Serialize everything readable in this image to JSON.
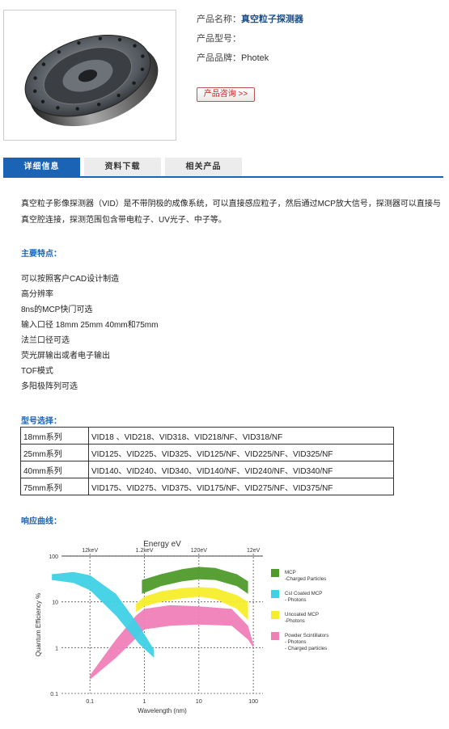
{
  "product": {
    "name_label": "产品名称：",
    "name_value": "真空粒子探测器",
    "model_label": "产品型号：",
    "model_value": "",
    "brand_label": "产品品牌：",
    "brand_value": "Photek",
    "inquiry_button": "产品咨询 >>"
  },
  "tabs": [
    {
      "label": "详细信息",
      "active": true
    },
    {
      "label": "资料下载",
      "active": false
    },
    {
      "label": "相关产品",
      "active": false
    }
  ],
  "intro": "真空粒子影像探测器（VID）是不带阴极的成像系统，可以直接感应粒子，然后通过MCP放大信号，探测器可以直接与真空腔连接，探测范围包含带电粒子、UV光子、中子等。",
  "features_title": "主要特点：",
  "features": [
    "可以按照客户CAD设计制造",
    "高分辨率",
    "8ns的MCP快门可选",
    "输入口径 18mm 25mm 40mm和75mm",
    "法兰口径可选",
    "荧光屏输出或者电子输出",
    "TOF模式",
    "多阳极阵列可选"
  ],
  "models_title": "型号选择：",
  "models": [
    {
      "series": "18mm系列",
      "models": "VID18 、VID218、VID318、VID218/NF、VID318/NF"
    },
    {
      "series": "25mm系列",
      "models": "VID125、VID225、VID325、VID125/NF、VID225/NF、VID325/NF"
    },
    {
      "series": "40mm系列",
      "models": "VID140、VID240、VID340、VID140/NF、VID240/NF、VID340/NF"
    },
    {
      "series": "75mm系列",
      "models": "VID175、VID275、VID375、VID175/NF、VID275/NF、VID375/NF"
    }
  ],
  "curve_title": "响应曲线：",
  "chart_data": {
    "type": "area",
    "title": "Energy eV",
    "xlabel": "Wavelength (nm)",
    "ylabel": "Quantum Efficiency %",
    "x_scale": "log",
    "y_scale": "log",
    "xlim": [
      0.03,
      150
    ],
    "ylim": [
      0.1,
      100
    ],
    "x_ticks": [
      "0.1",
      "1",
      "10",
      "100"
    ],
    "y_ticks": [
      "100",
      "10",
      "1",
      "0.1"
    ],
    "top_ticks": [
      {
        "label": "12keV",
        "x": 0.1
      },
      {
        "label": "1.2keV",
        "x": 1
      },
      {
        "label": "120eV",
        "x": 10
      },
      {
        "label": "12eV",
        "x": 100
      }
    ],
    "series": [
      {
        "name": "MCP\n-Charged Particles",
        "color": "#4f9a2b",
        "upper": [
          [
            0.9,
            30
          ],
          [
            2,
            40
          ],
          [
            5,
            52
          ],
          [
            10,
            58
          ],
          [
            20,
            55
          ],
          [
            50,
            40
          ],
          [
            80,
            28
          ]
        ],
        "lower": [
          [
            0.9,
            15
          ],
          [
            2,
            22
          ],
          [
            5,
            28
          ],
          [
            10,
            31
          ],
          [
            20,
            30
          ],
          [
            50,
            22
          ],
          [
            80,
            15
          ]
        ]
      },
      {
        "name": "CsI Coated MCP\n- Photons",
        "color": "#3fd1e6",
        "upper": [
          [
            0.02,
            40
          ],
          [
            0.05,
            45
          ],
          [
            0.1,
            38
          ],
          [
            0.3,
            15
          ],
          [
            0.8,
            3
          ],
          [
            1.5,
            0.9
          ]
        ],
        "lower": [
          [
            0.02,
            30
          ],
          [
            0.05,
            26
          ],
          [
            0.1,
            18
          ],
          [
            0.3,
            5
          ],
          [
            0.8,
            1.2
          ],
          [
            1.5,
            0.6
          ]
        ]
      },
      {
        "name": "Uncoated MCP\n-Photons",
        "color": "#f5ee2a",
        "upper": [
          [
            0.7,
            9
          ],
          [
            1,
            13
          ],
          [
            2,
            17
          ],
          [
            5,
            20
          ],
          [
            10,
            21
          ],
          [
            20,
            20
          ],
          [
            50,
            14
          ],
          [
            80,
            10
          ]
        ],
        "lower": [
          [
            0.7,
            6
          ],
          [
            1,
            8
          ],
          [
            2,
            10
          ],
          [
            5,
            12
          ],
          [
            10,
            13
          ],
          [
            20,
            11.5
          ],
          [
            50,
            7
          ],
          [
            80,
            4
          ]
        ]
      },
      {
        "name": "Powder Scintillators\n- Photons\n- Charged particles",
        "color": "#f07fb8",
        "upper": [
          [
            0.1,
            0.25
          ],
          [
            0.3,
            1.5
          ],
          [
            0.7,
            5
          ],
          [
            1,
            7
          ],
          [
            3,
            8.5
          ],
          [
            10,
            8
          ],
          [
            40,
            7
          ],
          [
            80,
            3
          ],
          [
            100,
            1.2
          ]
        ],
        "lower": [
          [
            0.1,
            0.2
          ],
          [
            0.3,
            0.6
          ],
          [
            0.7,
            1.6
          ],
          [
            1,
            2.5
          ],
          [
            3,
            3
          ],
          [
            10,
            3.2
          ],
          [
            40,
            3
          ],
          [
            80,
            1.5
          ],
          [
            100,
            1
          ]
        ]
      }
    ],
    "legend": "right",
    "grid": true
  }
}
